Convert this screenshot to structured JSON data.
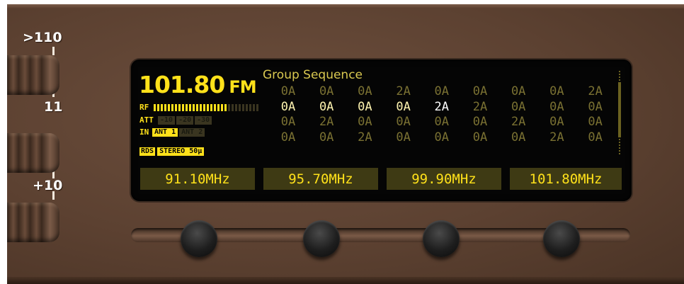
{
  "scale": {
    "labels": [
      ">110",
      "11",
      "+10"
    ]
  },
  "display": {
    "frequency": "101.80",
    "band": "FM",
    "rf_label": "RF",
    "rf_level": 0.7,
    "att_label": "ATT",
    "att_options": [
      "-10",
      "-20",
      "-30"
    ],
    "in_label": "IN",
    "antennas": [
      {
        "label": "ANT 1",
        "active": true
      },
      {
        "label": "ANT 2",
        "active": false
      }
    ],
    "rds_label": "RDS",
    "stereo_label": "STEREO 50μ",
    "group_title": "Group Sequence",
    "group_rows": [
      [
        "0A",
        "0A",
        "0A",
        "2A",
        "0A",
        "0A",
        "0A",
        "0A",
        "2A"
      ],
      [
        "0A",
        "0A",
        "0A",
        "0A",
        "2A",
        "2A",
        "0A",
        "0A",
        "0A"
      ],
      [
        "0A",
        "2A",
        "0A",
        "0A",
        "0A",
        "0A",
        "2A",
        "0A",
        "0A"
      ],
      [
        "0A",
        "0A",
        "2A",
        "0A",
        "0A",
        "0A",
        "0A",
        "2A",
        "0A"
      ]
    ],
    "presets": [
      "91.10MHz",
      "95.70MHz",
      "99.90MHz",
      "101.80MHz"
    ]
  },
  "colors": {
    "lcd_text": "#ffe11a",
    "lcd_background": "#050505",
    "panel": "#5c4131"
  }
}
